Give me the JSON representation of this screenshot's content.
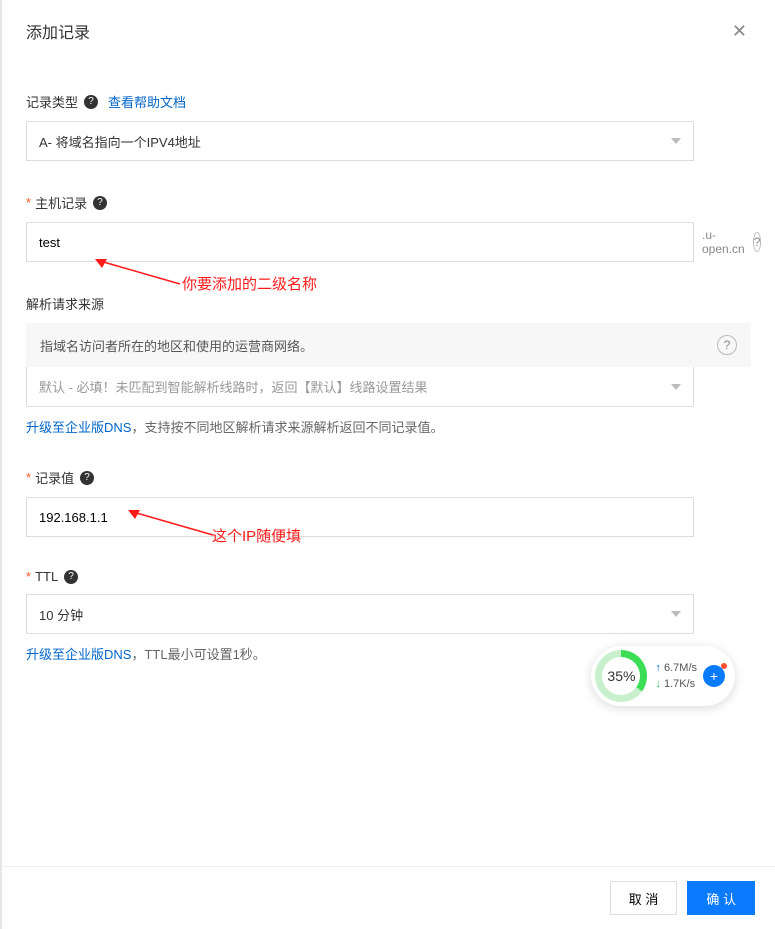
{
  "modal": {
    "title": "添加记录",
    "close_aria": "关闭"
  },
  "record_type": {
    "label": "记录类型",
    "help_link": "查看帮助文档",
    "value": "A- 将域名指向一个IPV4地址"
  },
  "host_record": {
    "label": "主机记录",
    "value": "test",
    "suffix": ".u-open.cn"
  },
  "source": {
    "label": "解析请求来源",
    "desc": "指域名访问者所在的地区和使用的运营商网络。",
    "placeholder": "默认 - 必填！未匹配到智能解析线路时，返回【默认】线路设置结果",
    "note_link": "升级至企业版DNS",
    "note_rest": "，支持按不同地区解析请求来源解析返回不同记录值。"
  },
  "record_value": {
    "label": "记录值",
    "value": "192.168.1.1"
  },
  "ttl": {
    "label": "TTL",
    "value": "10 分钟",
    "note_link": "升级至企业版DNS",
    "note_rest": "，TTL最小可设置1秒。"
  },
  "annotations": {
    "a1": "你要添加的二级名称",
    "a2": "这个IP随便填"
  },
  "widget": {
    "percent": "35%",
    "up": "6.7M/s",
    "down": "1.7K/s"
  },
  "footer": {
    "cancel": "取 消",
    "confirm": "确 认"
  }
}
